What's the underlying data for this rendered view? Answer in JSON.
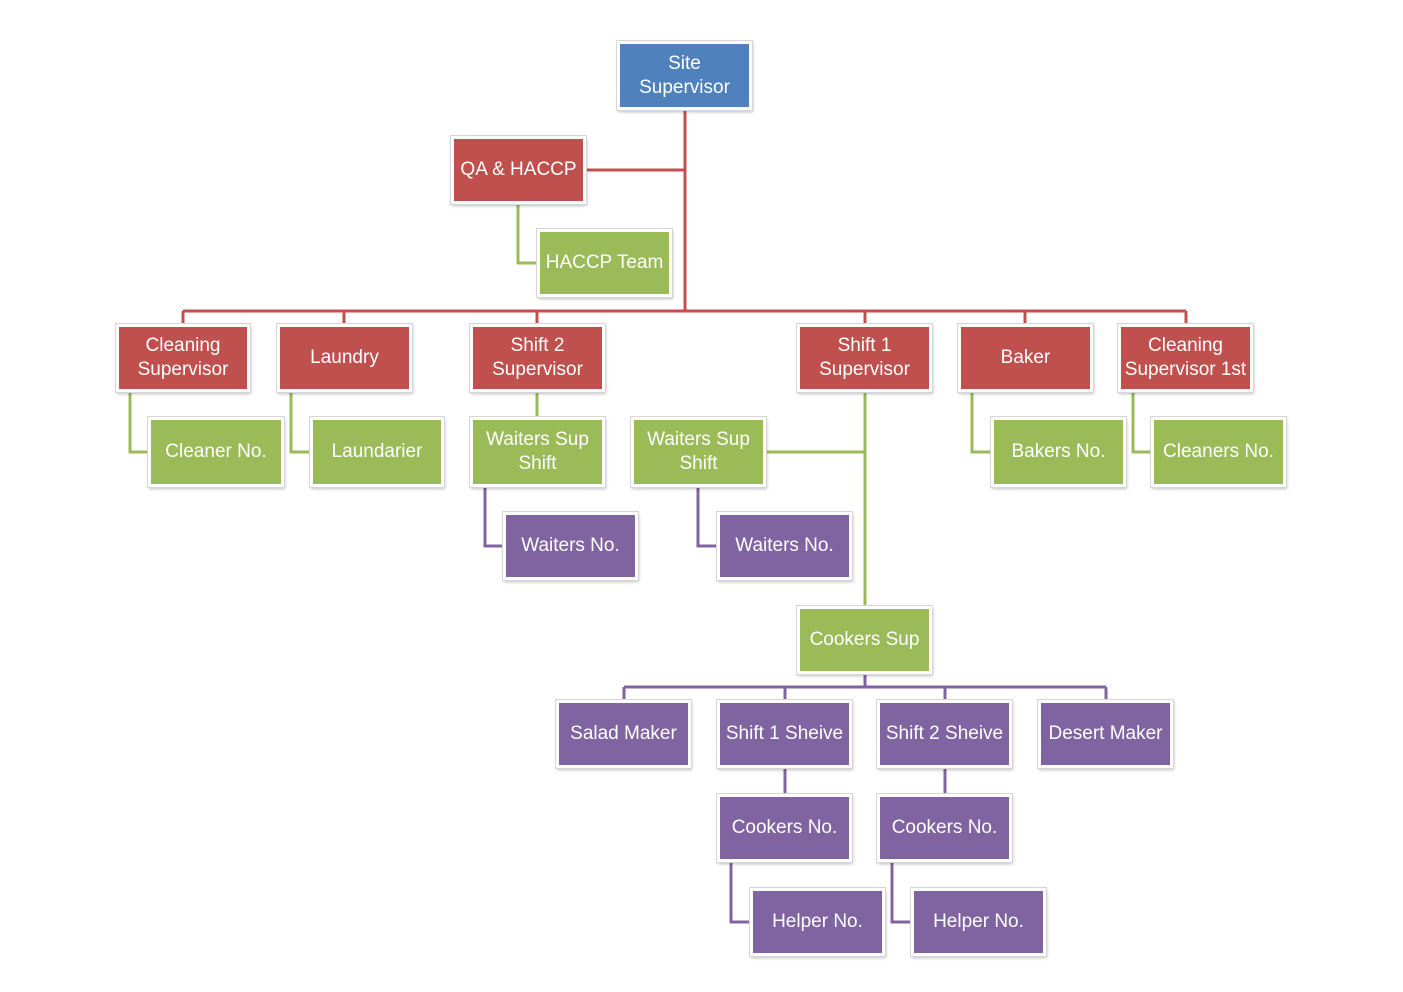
{
  "colors": {
    "blue": "#4F81BD",
    "red": "#C0504D",
    "green": "#9BBB59",
    "purple": "#8064A2"
  },
  "nodes": {
    "site_supervisor": "Site Supervisor",
    "qa_haccp": "QA & HACCP",
    "haccp_team": "HACCP Team",
    "cleaning_supervisor": "Cleaning Supervisor",
    "laundry": "Laundry",
    "shift2_supervisor": "Shift 2 Supervisor",
    "shift1_supervisor": "Shift 1 Supervisor",
    "baker": "Baker",
    "cleaning_supervisor_1st": "Cleaning Supervisor 1st",
    "cleaner_no": "Cleaner No.",
    "laundarier": "Laundarier",
    "waiters_sup_shift_2": "Waiters Sup Shift",
    "waiters_sup_shift_1": "Waiters Sup Shift",
    "bakers_no": "Bakers No.",
    "cleaners_no": "Cleaners No.",
    "waiters_no_2": "Waiters No.",
    "waiters_no_1": "Waiters No.",
    "cookers_sup": "Cookers Sup",
    "salad_maker": "Salad Maker",
    "shift1_sheive": "Shift 1 Sheive",
    "shift2_sheive": "Shift 2 Sheive",
    "desert_maker": "Desert Maker",
    "cookers_no_1": "Cookers No.",
    "cookers_no_2": "Cookers No.",
    "helper_no_1": "Helper No.",
    "helper_no_2": "Helper No."
  }
}
